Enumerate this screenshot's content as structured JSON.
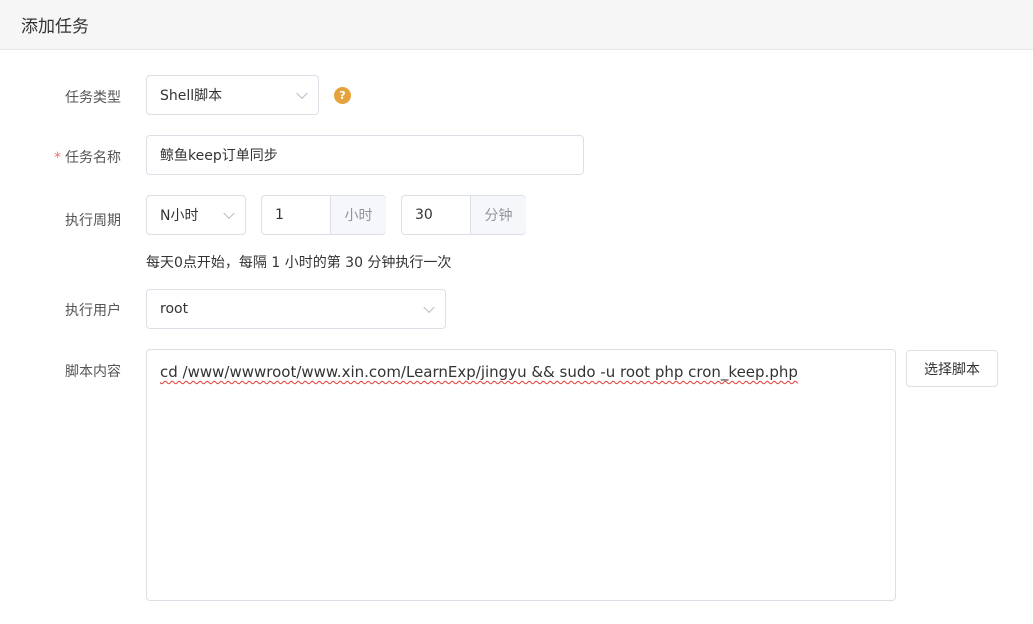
{
  "header": {
    "title": "添加任务"
  },
  "form": {
    "task_type": {
      "label": "任务类型",
      "value": "Shell脚本",
      "help_icon": "?"
    },
    "task_name": {
      "label": "任务名称",
      "required_mark": "*",
      "value": "鲸鱼keep订单同步"
    },
    "period": {
      "label": "执行周期",
      "mode": "N小时",
      "hours_value": "1",
      "hours_unit": "小时",
      "minutes_value": "30",
      "minutes_unit": "分钟",
      "hint": "每天0点开始，每隔 1 小时的第 30 分钟执行一次"
    },
    "user": {
      "label": "执行用户",
      "value": "root"
    },
    "script": {
      "label": "脚本内容",
      "content": "cd /www/wwwroot/www.xin.com/LearnExp/jingyu && sudo -u root php cron_keep.php",
      "choose_button": "选择脚本"
    }
  },
  "colors": {
    "required": "#f56c6c",
    "help_icon_bg": "#e6a23c",
    "header_bg": "#f6f6f6",
    "border": "#dcdfe6",
    "addon_bg": "#f5f7fa"
  }
}
